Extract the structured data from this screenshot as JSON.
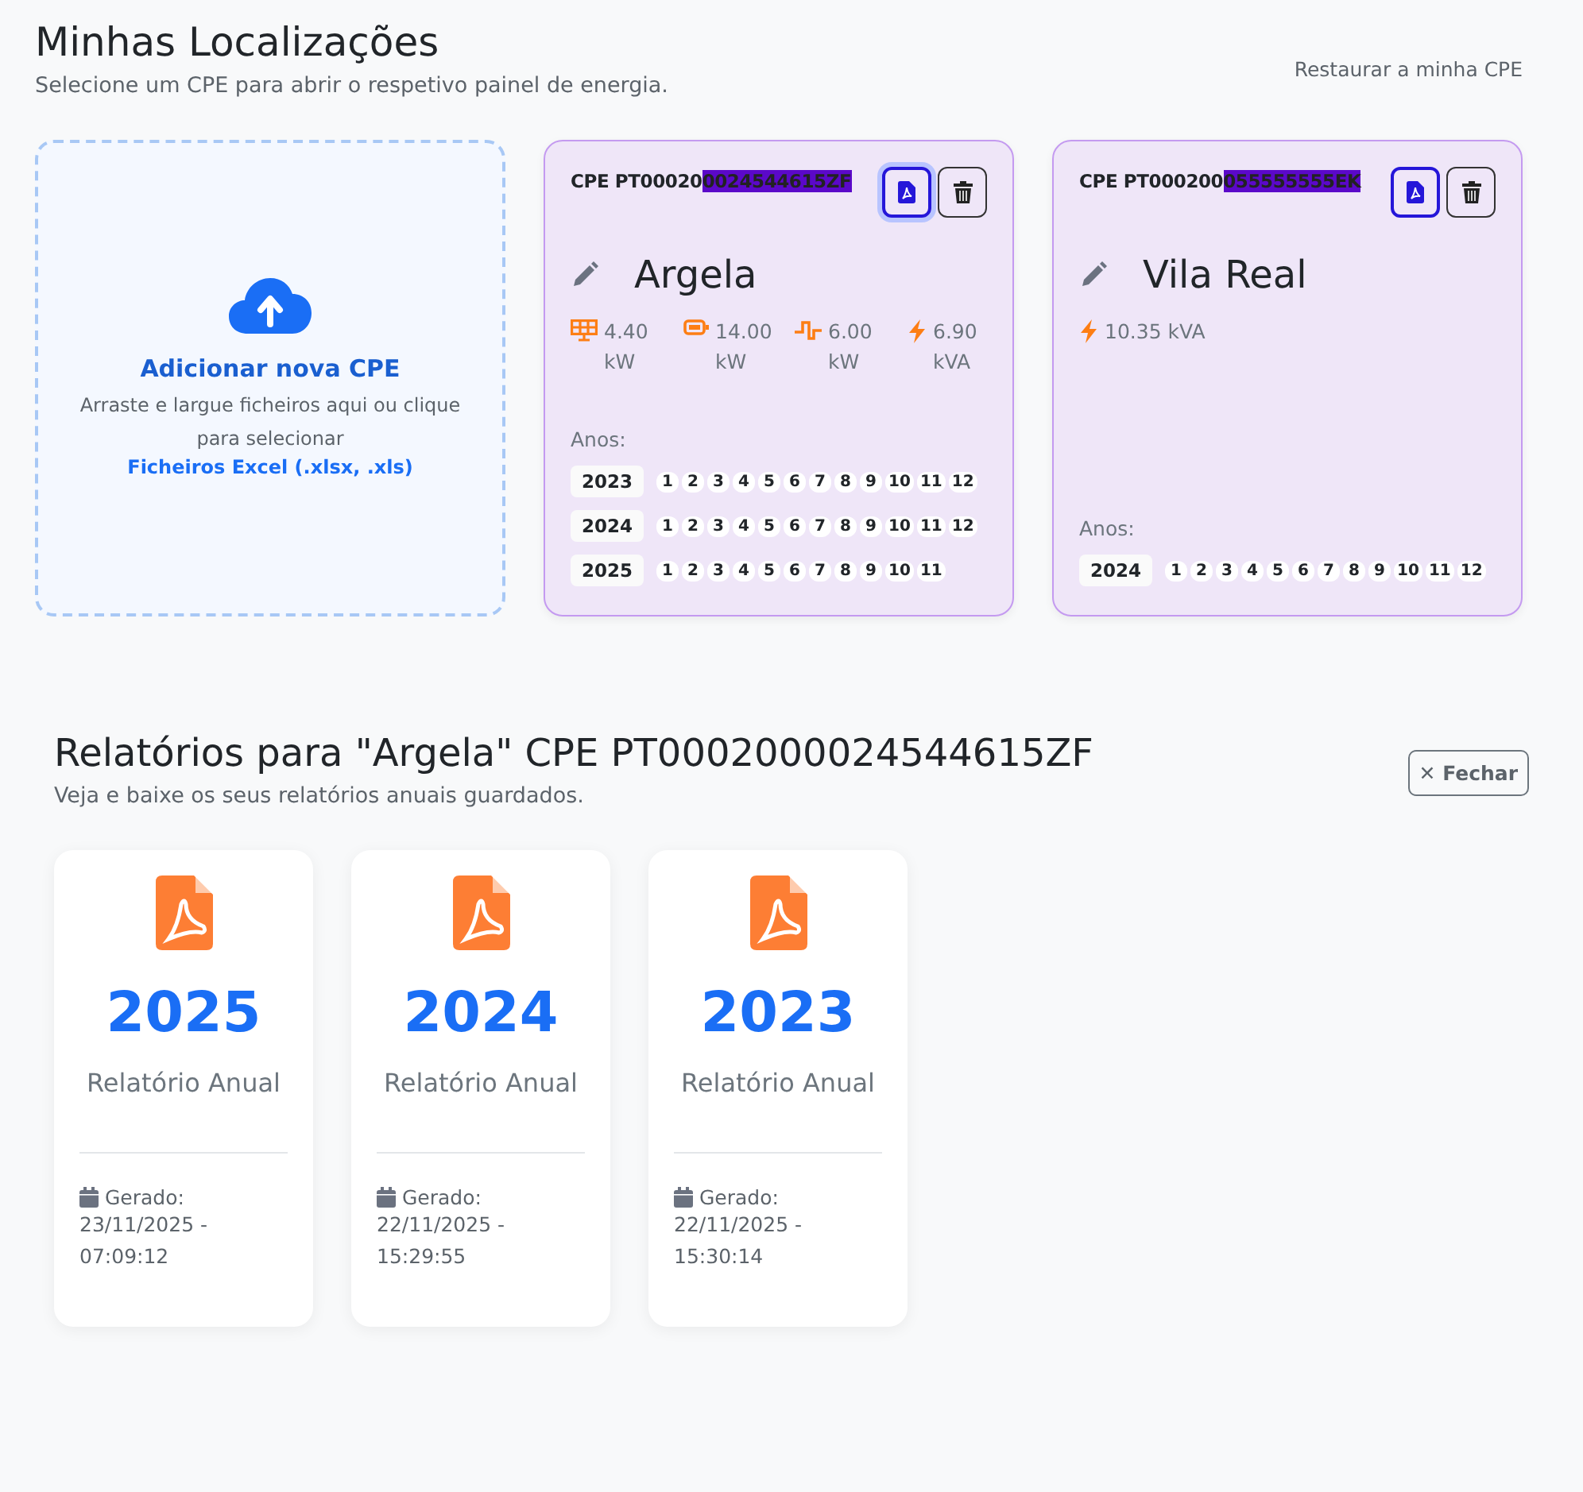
{
  "header": {
    "title": "Minhas Localizações",
    "subtitle": "Selecione um CPE para abrir o respetivo painel de energia.",
    "restore_link": "Restaurar a minha CPE"
  },
  "upload": {
    "title": "Adicionar nova CPE",
    "hint": "Arraste e largue ficheiros aqui ou clique para selecionar",
    "formats": "Ficheiros Excel (.xlsx, .xls)"
  },
  "locations": [
    {
      "cpe_prefix": "CPE PT00020",
      "cpe_marked": "0024544615ZF",
      "pdf_focused": true,
      "name": "Argela",
      "stats": [
        {
          "kind": "solar",
          "value": "4.40 kW"
        },
        {
          "kind": "battery",
          "value": "14.00 kW"
        },
        {
          "kind": "grid",
          "value": "6.00 kW"
        },
        {
          "kind": "power",
          "value": "6.90 kVA"
        }
      ],
      "years_label": "Anos:",
      "years": [
        {
          "year": "2023",
          "months": [
            "1",
            "2",
            "3",
            "4",
            "5",
            "6",
            "7",
            "8",
            "9",
            "10",
            "11",
            "12"
          ]
        },
        {
          "year": "2024",
          "months": [
            "1",
            "2",
            "3",
            "4",
            "5",
            "6",
            "7",
            "8",
            "9",
            "10",
            "11",
            "12"
          ]
        },
        {
          "year": "2025",
          "months": [
            "1",
            "2",
            "3",
            "4",
            "5",
            "6",
            "7",
            "8",
            "9",
            "10",
            "11"
          ]
        }
      ]
    },
    {
      "cpe_prefix": "CPE PT000200",
      "cpe_marked": "055555555EK",
      "pdf_focused": false,
      "name": "Vila Real",
      "stats": [
        {
          "kind": "power",
          "value": "10.35 kVA"
        }
      ],
      "years_label": "Anos:",
      "years": [
        {
          "year": "2024",
          "months": [
            "1",
            "2",
            "3",
            "4",
            "5",
            "6",
            "7",
            "8",
            "9",
            "10",
            "11",
            "12"
          ]
        }
      ]
    }
  ],
  "reports": {
    "title": "Relatórios para \"Argela\" CPE PT0002000024544615ZF",
    "subtitle": "Veja e baixe os seus relatórios anuais guardados.",
    "close_button": "✕ Fechar",
    "items": [
      {
        "year": "2025",
        "label": "Relatório Anual",
        "generated_label": "Gerado:",
        "generated": "23/11/2025 - 07:09:12"
      },
      {
        "year": "2024",
        "label": "Relatório Anual",
        "generated_label": "Gerado:",
        "generated": "22/11/2025 - 15:29:55"
      },
      {
        "year": "2023",
        "label": "Relatório Anual",
        "generated_label": "Gerado:",
        "generated": "22/11/2025 - 15:30:14"
      }
    ]
  }
}
